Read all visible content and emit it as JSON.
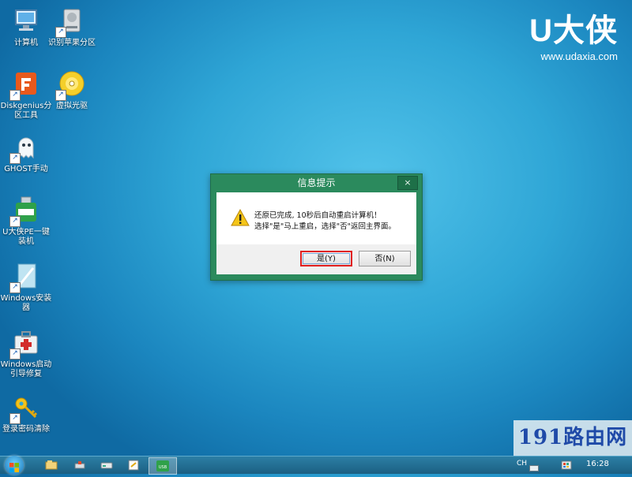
{
  "desktop": {
    "icons": [
      {
        "label": "计算机",
        "icon": "computer-icon"
      },
      {
        "label": "识别苹果分区",
        "icon": "drive-icon"
      },
      {
        "label": "Diskgenius分区工具",
        "icon": "diskgenius-icon"
      },
      {
        "label": "虚拟光驱",
        "icon": "virtual-drive-icon"
      },
      {
        "label": "GHOST手动",
        "icon": "ghost-icon"
      },
      {
        "label": "U大侠PE一键装机",
        "icon": "usb-installer-icon"
      },
      {
        "label": "Windows安装器",
        "icon": "windows-installer-icon"
      },
      {
        "label": "Windows启动引导修复",
        "icon": "boot-repair-icon"
      },
      {
        "label": "登录密码清除",
        "icon": "key-icon"
      }
    ]
  },
  "brand": {
    "name": "U大侠",
    "url": "www.udaxia.com"
  },
  "dialog": {
    "title": "信息提示",
    "close_label": "×",
    "message_line1": "还原已完成, 10秒后自动重启计算机！",
    "message_line2": "选择\"是\"马上重启，选择\"否\"返回主界面。",
    "yes_label": "是(Y)",
    "no_label": "否(N)"
  },
  "watermark": {
    "text": "191路由网"
  },
  "taskbar": {
    "lang": "CH",
    "time": "16:28",
    "active_item_label": "USB"
  },
  "colors": {
    "dialog_frame": "#2b8a5d",
    "desktop": "#2fa6d6",
    "highlight": "#e02020"
  }
}
